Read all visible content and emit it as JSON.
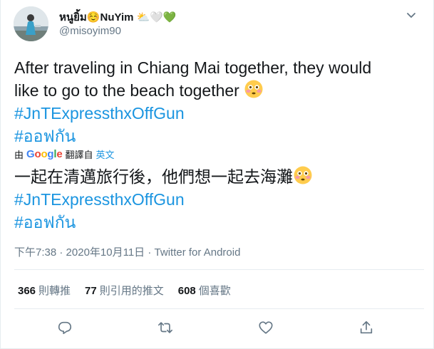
{
  "user": {
    "display_name": "หนูยิ้ม☺️NuYim",
    "name_emojis": "⛅🤍💚",
    "handle": "@misoyim90"
  },
  "tweet": {
    "line1": "After traveling in Chiang Mai together, they would",
    "line2": "like to go to the beach together",
    "hashtag1": "#JnTExpressthxOffGun",
    "hashtag2": "#ออฟกัน"
  },
  "translation": {
    "prefix": "由",
    "provider": "Google",
    "action": "翻譯自",
    "language": "英文",
    "text": "一起在清邁旅行後，他們想一起去海灘",
    "hashtag1": "#JnTExpressthxOffGun",
    "hashtag2": "#ออฟกัน"
  },
  "meta": {
    "time": "下午7:38",
    "separator1": " · ",
    "date": "2020年10月11日",
    "separator2": " · ",
    "client": "Twitter for Android"
  },
  "stats": {
    "retweets_count": "366",
    "retweets_label": "則轉推",
    "quotes_count": "77",
    "quotes_label": "則引用的推文",
    "likes_count": "608",
    "likes_label": "個喜歡"
  },
  "colors": {
    "link": "#1b95e0",
    "text": "#14171a",
    "secondary": "#657786",
    "divider": "#e6ecf0"
  },
  "icons": [
    "chevron-down-icon",
    "reply-icon",
    "retweet-icon",
    "like-icon",
    "share-icon",
    "flushed-face-emoji"
  ]
}
